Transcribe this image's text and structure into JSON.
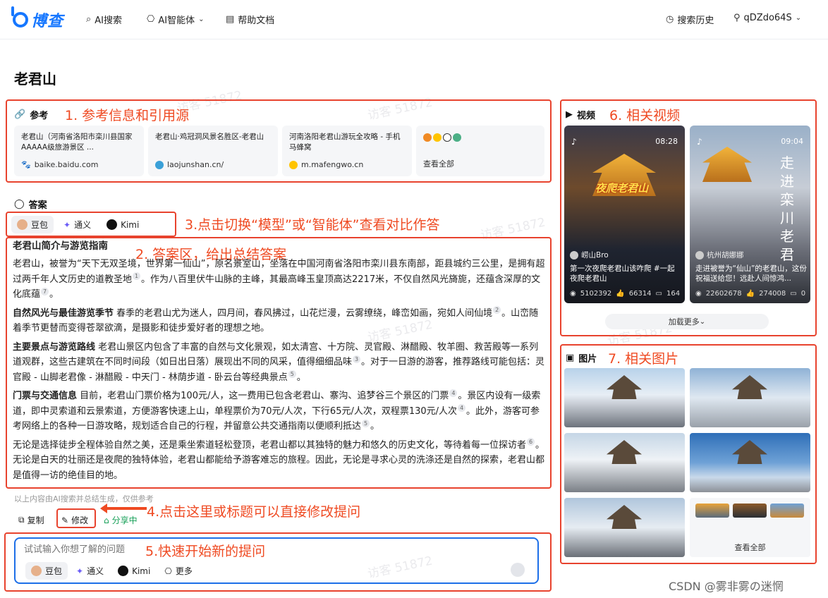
{
  "nav": {
    "logo": "博查",
    "items": [
      "AI搜索",
      "AI智能体",
      "帮助文档"
    ],
    "history": "搜索历史",
    "user": "qDZdo64S"
  },
  "page_title": "老君山",
  "reference": {
    "heading": "参考",
    "cards": [
      {
        "title": "老君山（河南省洛阳市栾川县国家AAAAA级旅游景区 ...",
        "source": "baike.baidu.com"
      },
      {
        "title": "老君山·鸡冠洞风景名胜区-老君山",
        "source": "laojunshan.cn/"
      },
      {
        "title": "河南洛阳老君山游玩全攻略 - 手机马蜂窝",
        "source": "m.mafengwo.cn"
      }
    ],
    "view_all": "查看全部"
  },
  "answer": {
    "heading": "答案",
    "models": [
      "豆包",
      "通义",
      "Kimi"
    ],
    "title": "老君山简介与游览指南",
    "para1": "老君山，被誉为“天下无双圣境，世界第一仙山”，原名景室山，坐落在中国河南省洛阳市栾川县东南部，距县城约三公里，是拥有超过两千年人文历史的道教圣地",
    "para1b": "。作为八百里伏牛山脉的主峰，其最高峰玉皇顶高达2217米，不仅自然风光旖旎，还蕴含深厚的文化底蕴",
    "p2_head": "自然风光与最佳游览季节",
    "p2": "春季的老君山尤为迷人，四月间，春风拂过，山花烂漫，云雾缭绕，峰峦如画，宛如人间仙境",
    "p2b": "。山峦随着季节更替而变得苍翠欲滴，是摄影和徒步爱好者的理想之地。",
    "p3_head": "主要景点与游览路线",
    "p3": "老君山景区内包含了丰富的自然与文化景观，如太清宫、十方院、灵官殿、淋醋殿、牧羊圈、救苦殿等一系列道观群，这些古建筑在不同时间段（如日出日落）展现出不同的风采，值得细细品味",
    "p3b": "。对于一日游的游客，推荐路线可能包括：灵官殿 - 山脚老君像 - 淋醋殿 - 中天门 - 林荫步道 - 卧云台等经典景点",
    "p4_head": "门票与交通信息",
    "p4": "目前，老君山门票价格为100元/人，这一费用已包含老君山、寨沟、追梦谷三个景区的门票",
    "p4b": "。景区内设有一级索道，即中灵索道和云景索道，方便游客快速上山，单程票价为70元/人次，下行65元/人次，双程票130元/人次",
    "p4c": "。此外，游客可参考网络上的各种一日游攻略，规划适合自己的行程，并留意公共交通指南以便顺利抵达",
    "p5": "无论是选择徒步全程体验自然之美，还是乘坐索道轻松登顶，老君山都以其独特的魅力和悠久的历史文化，等待着每一位探访者",
    "p5b": "。无论是白天的壮丽还是夜爬的独特体验，老君山都能给予游客难忘的旅程。因此，无论是寻求心灵的洗涤还是自然的探索，老君山都是值得一访的绝佳目的地。",
    "cites": [
      "1",
      "7",
      "2",
      "3",
      "5",
      "4",
      "4",
      "5",
      "6"
    ],
    "disclaimer": "以上内容由AI搜索并总结生成，仅供参考",
    "copy": "复制",
    "edit": "修改",
    "share": "分享中"
  },
  "input": {
    "placeholder": "试试输入你想了解的问题",
    "models": [
      "豆包",
      "通义",
      "Kimi",
      "更多"
    ]
  },
  "videos": {
    "heading": "视频",
    "items": [
      {
        "duration": "08:28",
        "overlay": "夜爬老君山",
        "author": "崂山Bro",
        "caption": "第一次夜爬老君山该咋爬 #一起夜爬老君山",
        "views": "5102392",
        "likes": "66314",
        "comments": "164"
      },
      {
        "duration": "09:04",
        "overlay": "走进栾川老君",
        "author": "杭州胡娜娜",
        "caption": "走进被誉为“仙山”的老君山，这份祝福送给您！远赴人间惊鸿...",
        "views": "22602678",
        "likes": "274008",
        "comments": "0"
      }
    ],
    "load_more": "加载更多"
  },
  "images": {
    "heading": "图片",
    "view_all": "查看全部"
  },
  "annotations": {
    "a1": "1. 参考信息和引用源",
    "a2": "2. 答案区，给出总结答案",
    "a3": "3.点击切换“模型”或“智能体”查看对比作答",
    "a4": "4.点击这里或标题可以直接修改提问",
    "a5": "5.快速开始新的提问",
    "a6": "6. 相关视频",
    "a7": "7. 相关图片"
  },
  "watermark": "访客 51872",
  "footer_mark": "CSDN @雾非雾の迷惘"
}
